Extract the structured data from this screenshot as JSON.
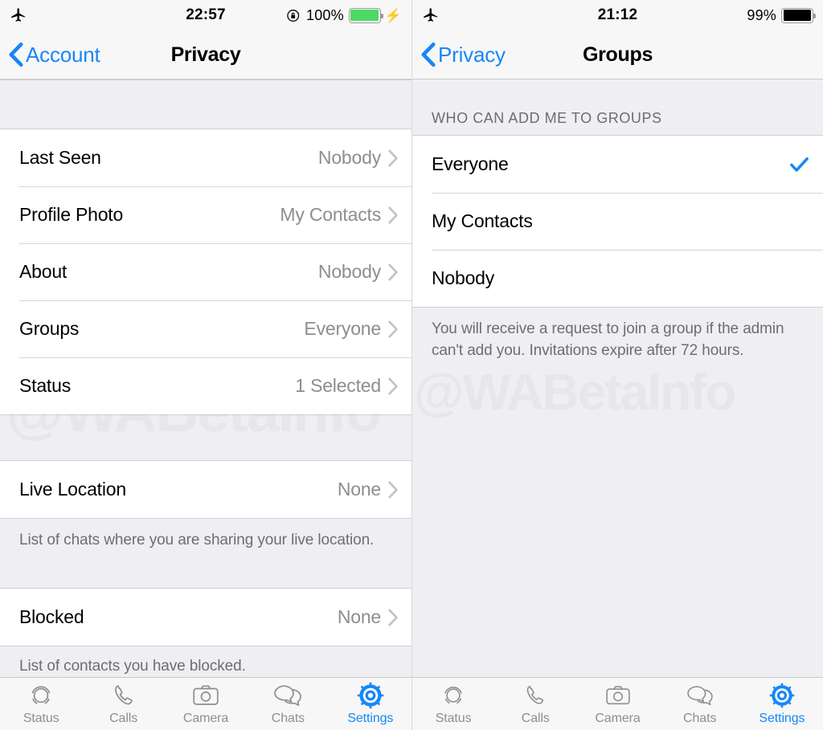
{
  "watermark": "@WABetaInfo",
  "colors": {
    "accent": "#1787f7",
    "battery_full": "#4cd964",
    "battery_dark": "#000000",
    "value_gray": "#8d8d92",
    "group_bg": "#eeeef3"
  },
  "left": {
    "status_bar": {
      "airplane_icon": "airplane-icon",
      "time": "22:57",
      "rotation_lock_icon": "rotation-lock-icon",
      "battery_percent": "100%",
      "battery_level": 100,
      "charging_icon": "lightning-bolt-icon"
    },
    "nav": {
      "back_icon": "chevron-left-icon",
      "back_label": "Account",
      "title": "Privacy"
    },
    "rows_group_1": [
      {
        "label": "Last Seen",
        "value": "Nobody"
      },
      {
        "label": "Profile Photo",
        "value": "My Contacts"
      },
      {
        "label": "About",
        "value": "Nobody"
      },
      {
        "label": "Groups",
        "value": "Everyone"
      },
      {
        "label": "Status",
        "value": "1 Selected"
      }
    ],
    "rows_group_2": [
      {
        "label": "Live Location",
        "value": "None"
      }
    ],
    "footnote_1": "List of chats where you are sharing your live location.",
    "rows_group_3": [
      {
        "label": "Blocked",
        "value": "None"
      }
    ],
    "footnote_2": "List of contacts you have blocked.",
    "tabs": [
      {
        "label": "Status",
        "icon": "status-rings-icon",
        "active": false
      },
      {
        "label": "Calls",
        "icon": "phone-icon",
        "active": false
      },
      {
        "label": "Camera",
        "icon": "camera-icon",
        "active": false
      },
      {
        "label": "Chats",
        "icon": "chat-bubbles-icon",
        "active": false
      },
      {
        "label": "Settings",
        "icon": "gear-icon",
        "active": true
      }
    ]
  },
  "right": {
    "status_bar": {
      "airplane_icon": "airplane-icon",
      "time": "21:12",
      "battery_percent": "99%",
      "battery_level": 99
    },
    "nav": {
      "back_icon": "chevron-left-icon",
      "back_label": "Privacy",
      "title": "Groups"
    },
    "section_header": "WHO CAN ADD ME TO GROUPS",
    "options": [
      {
        "label": "Everyone",
        "selected": true
      },
      {
        "label": "My Contacts",
        "selected": false
      },
      {
        "label": "Nobody",
        "selected": false
      }
    ],
    "footnote": "You will receive a request to join a group if the admin can't add you. Invitations expire after 72 hours.",
    "tabs": [
      {
        "label": "Status",
        "icon": "status-rings-icon",
        "active": false
      },
      {
        "label": "Calls",
        "icon": "phone-icon",
        "active": false
      },
      {
        "label": "Camera",
        "icon": "camera-icon",
        "active": false
      },
      {
        "label": "Chats",
        "icon": "chat-bubbles-icon",
        "active": false
      },
      {
        "label": "Settings",
        "icon": "gear-icon",
        "active": true
      }
    ]
  }
}
